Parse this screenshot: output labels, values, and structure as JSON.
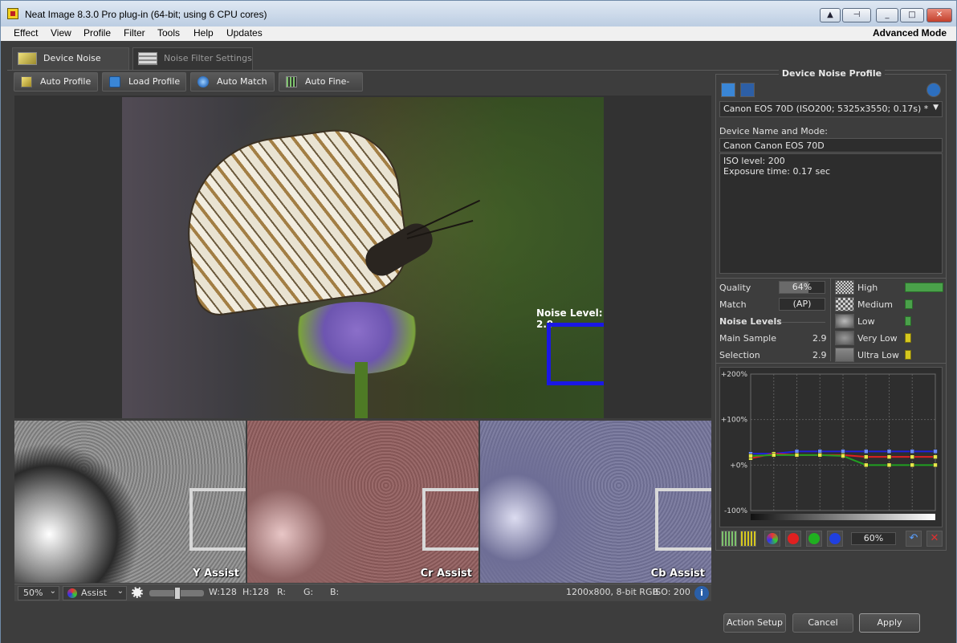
{
  "window": {
    "title": "Neat Image 8.3.0 Pro plug-in (64-bit; using 6 CPU cores)"
  },
  "menu": {
    "items": [
      "Effect",
      "View",
      "Profile",
      "Filter",
      "Tools",
      "Help",
      "Updates"
    ],
    "mode": "Advanced Mode"
  },
  "tabs": [
    {
      "label": "Device Noise Profile",
      "active": true
    },
    {
      "label": "Noise Filter Settings",
      "active": false
    }
  ],
  "toolbar": {
    "auto_profile": "Auto Profile",
    "load_profile": "Load Profile",
    "auto_match": "Auto Match",
    "auto_fine_tune": "Auto Fine-Tune"
  },
  "preview": {
    "noise_level_label": "Noise Level: 2.9"
  },
  "assist": {
    "y": "Y Assist",
    "cr": "Cr Assist",
    "cb": "Cb Assist"
  },
  "statusbar": {
    "zoom": "50%",
    "view_mode": "Assist",
    "width": "W:128",
    "height": "H:128",
    "r": "R:",
    "g": "G:",
    "b": "B:",
    "image_info": "1200x800, 8-bit RGB",
    "iso": "ISO: 200",
    "info_glyph": "i"
  },
  "profile_panel": {
    "title": "Device Noise Profile",
    "profile_selected": "Canon EOS 70D (ISO200; 5325x3550; 0.17s) *",
    "device_name_label": "Device Name and Mode:",
    "device_name_value": "Canon Canon EOS 70D",
    "details_line1": "ISO level: 200",
    "details_line2": "Exposure time: 0.17 sec",
    "quality_label": "Quality",
    "quality_value": "64%",
    "quality_fraction": 0.64,
    "match_label": "Match",
    "match_value": "(AP)",
    "noise_levels_heading": "Noise Levels",
    "main_sample_label": "Main Sample",
    "main_sample_value": "2.9",
    "selection_label": "Selection",
    "selection_value": "2.9",
    "freq": [
      {
        "label": "High",
        "level": 1.0,
        "color": "#4aa14a"
      },
      {
        "label": "Medium",
        "level": 0.2,
        "color": "#4aa14a"
      },
      {
        "label": "Low",
        "level": 0.15,
        "color": "#4aa14a"
      },
      {
        "label": "Very Low",
        "level": 0.1,
        "color": "#d6c81e"
      },
      {
        "label": "Ultra Low",
        "level": 0.1,
        "color": "#d6c81e"
      }
    ],
    "graph_ticks": [
      "+200%",
      "+100%",
      "+0%",
      "-100%"
    ],
    "graph_zoom": "60%"
  },
  "chart_data": {
    "type": "line",
    "ylim": [
      -100,
      200
    ],
    "x": [
      0,
      1,
      2,
      3,
      4,
      5,
      6,
      7,
      8
    ],
    "series": [
      {
        "color": "#2020e0",
        "values": [
          25,
          25,
          30,
          30,
          30,
          30,
          30,
          30,
          30
        ]
      },
      {
        "color": "#e02020",
        "values": [
          15,
          25,
          22,
          22,
          22,
          18,
          18,
          18,
          18
        ]
      },
      {
        "color": "#20a020",
        "values": [
          20,
          22,
          22,
          22,
          20,
          0,
          0,
          0,
          0
        ]
      }
    ]
  },
  "buttons": {
    "action_setup": "Action Setup",
    "cancel": "Cancel",
    "apply": "Apply"
  },
  "colors": {
    "selection_box": "#1a17e6",
    "accent": "#2d5fa6"
  }
}
